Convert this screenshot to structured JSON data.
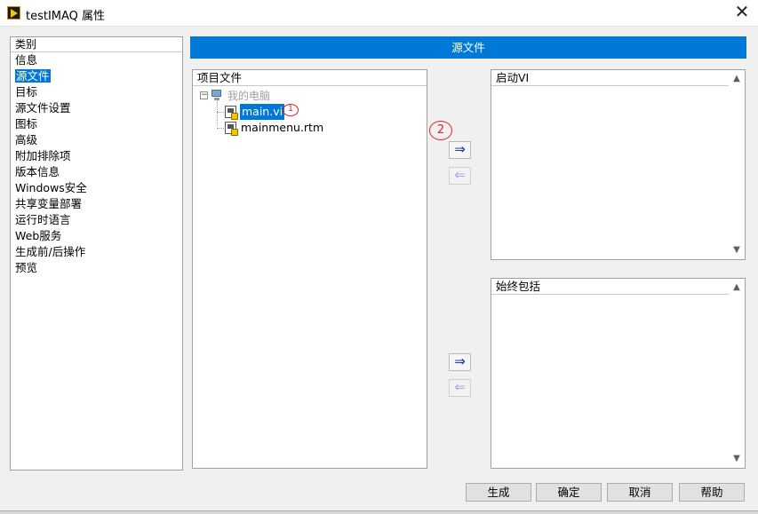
{
  "window": {
    "title": "testIMAQ 属性",
    "close_glyph": "✕"
  },
  "category": {
    "header": "类别",
    "items": [
      {
        "label": "信息"
      },
      {
        "label": "源文件",
        "selected": true
      },
      {
        "label": "目标"
      },
      {
        "label": "源文件设置"
      },
      {
        "label": "图标"
      },
      {
        "label": "高级"
      },
      {
        "label": "附加排除项"
      },
      {
        "label": "版本信息"
      },
      {
        "label": "Windows安全"
      },
      {
        "label": "共享变量部署"
      },
      {
        "label": "运行时语言"
      },
      {
        "label": "Web服务"
      },
      {
        "label": "生成前/后操作"
      },
      {
        "label": "预览"
      }
    ]
  },
  "section": {
    "title": "源文件"
  },
  "project_files": {
    "header": "项目文件",
    "root_label": "我的电脑",
    "expander_glyph": "−",
    "files": [
      {
        "label": "main.vi",
        "selected": true
      },
      {
        "label": "mainmenu.rtm",
        "selected": false
      }
    ]
  },
  "annotations": {
    "mark_1": "1",
    "mark_2": "2"
  },
  "arrows": {
    "add": "⇒",
    "remove": "⇐"
  },
  "startup_vis": {
    "header": "启动VI"
  },
  "always_included": {
    "header": "始终包括"
  },
  "scroll": {
    "up": "▲",
    "down": "▼"
  },
  "buttons": {
    "build": "生成",
    "ok": "确定",
    "cancel": "取消",
    "help": "帮助"
  },
  "colors": {
    "accent": "#0078d7",
    "annotation": "#e02020"
  },
  "icons": {
    "app": "labview-vi-icon",
    "computer": "computer-icon",
    "vi_file": "vi-file-icon",
    "rtm_file": "rtm-file-icon"
  }
}
